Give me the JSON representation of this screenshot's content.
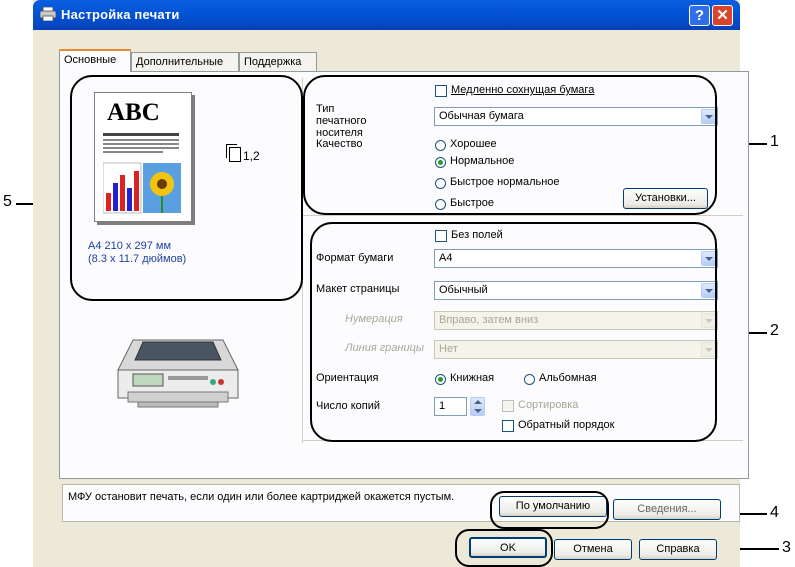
{
  "window": {
    "title": "Настройка печати",
    "help_glyph": "?",
    "close_glyph": "✕"
  },
  "tabs": [
    {
      "label": "Основные",
      "active": true
    },
    {
      "label": "Дополнительные",
      "active": false
    },
    {
      "label": "Поддержка",
      "active": false
    }
  ],
  "preview": {
    "doc_text": "ABC",
    "copies_glyph": "1,2",
    "paper_size_line1": "A4 210 x 297 мм",
    "paper_size_line2": "(8.3 x 11.7 дюймов)"
  },
  "media": {
    "slow_dry_label": "Медленно сохнущая бумага",
    "slow_dry_checked": false,
    "media_type_label": "Тип печатного носителя",
    "media_type_value": "Обычная бумага",
    "quality_label": "Качество",
    "quality_options": [
      "Хорошее",
      "Нормальное",
      "Быстрое нормальное",
      "Быстрое"
    ],
    "quality_selected": "Нормальное",
    "settings_button": "Установки..."
  },
  "paper": {
    "borderless_label": "Без полей",
    "borderless_checked": false,
    "size_label": "Формат бумаги",
    "size_value": "A4",
    "layout_label": "Макет страницы",
    "layout_value": "Обычный",
    "order_label": "Нумерация",
    "order_value": "Вправо, затем вниз",
    "border_label": "Линия границы",
    "border_value": "Нет",
    "orientation_label": "Ориентация",
    "orientation_portrait": "Книжная",
    "orientation_landscape": "Альбомная",
    "orientation_selected": "Книжная",
    "copies_label": "Число копий",
    "copies_value": "1",
    "collate_label": "Сортировка",
    "reverse_label": "Обратный порядок",
    "reverse_checked": false
  },
  "status": {
    "message": "МФУ остановит печать, если один или более картриджей окажется пустым.",
    "default_button": "По умолчанию",
    "about_button": "Сведения..."
  },
  "footer": {
    "ok": "OK",
    "cancel": "Отмена",
    "help": "Справка"
  },
  "callouts": [
    "1",
    "2",
    "3",
    "4",
    "5"
  ],
  "colors": {
    "title_bar": "#0554d6",
    "dialog_bg": "#ece9d8",
    "panel_bg": "#fcfcfe",
    "radio_dot": "#2a9a2a"
  }
}
